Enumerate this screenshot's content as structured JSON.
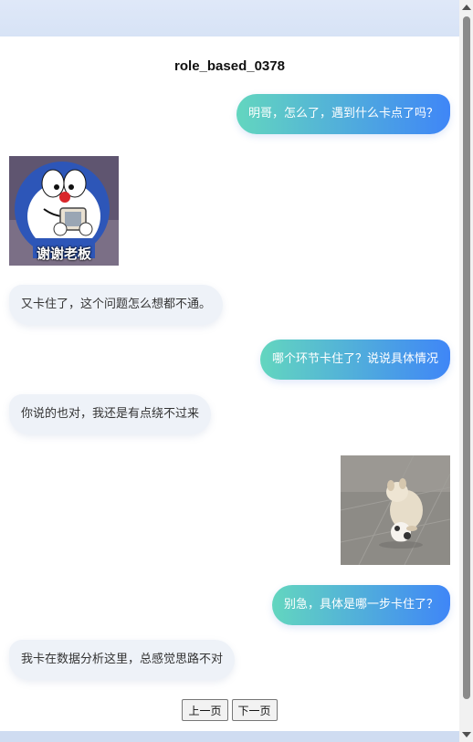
{
  "conversation": {
    "title": "role_based_0378"
  },
  "messages": [
    {
      "side": "right",
      "type": "text",
      "text": "明哥，怎么了，遇到什么卡点了吗？"
    },
    {
      "side": "left",
      "type": "image",
      "image": "doraemon-sticker",
      "caption": "谢谢老板"
    },
    {
      "side": "left",
      "type": "text",
      "text": "又卡住了，这个问题怎么想都不通。"
    },
    {
      "side": "right",
      "type": "text",
      "text": "哪个环节卡住了？说说具体情况"
    },
    {
      "side": "left",
      "type": "text",
      "text": "你说的也对，我还是有点绕不过来"
    },
    {
      "side": "right",
      "type": "image",
      "image": "puppy-with-ball-photo"
    },
    {
      "side": "right",
      "type": "text",
      "text": "别急，具体是哪一步卡住了？"
    },
    {
      "side": "left",
      "type": "text",
      "text": "我卡在数据分析这里，总感觉思路不对"
    }
  ],
  "pagination": {
    "prev_label": "上一页",
    "next_label": "下一页"
  },
  "colors": {
    "right_bubble_start": "#63d6bf",
    "right_bubble_end": "#3f86f7",
    "left_bubble": "#eef2f8"
  }
}
